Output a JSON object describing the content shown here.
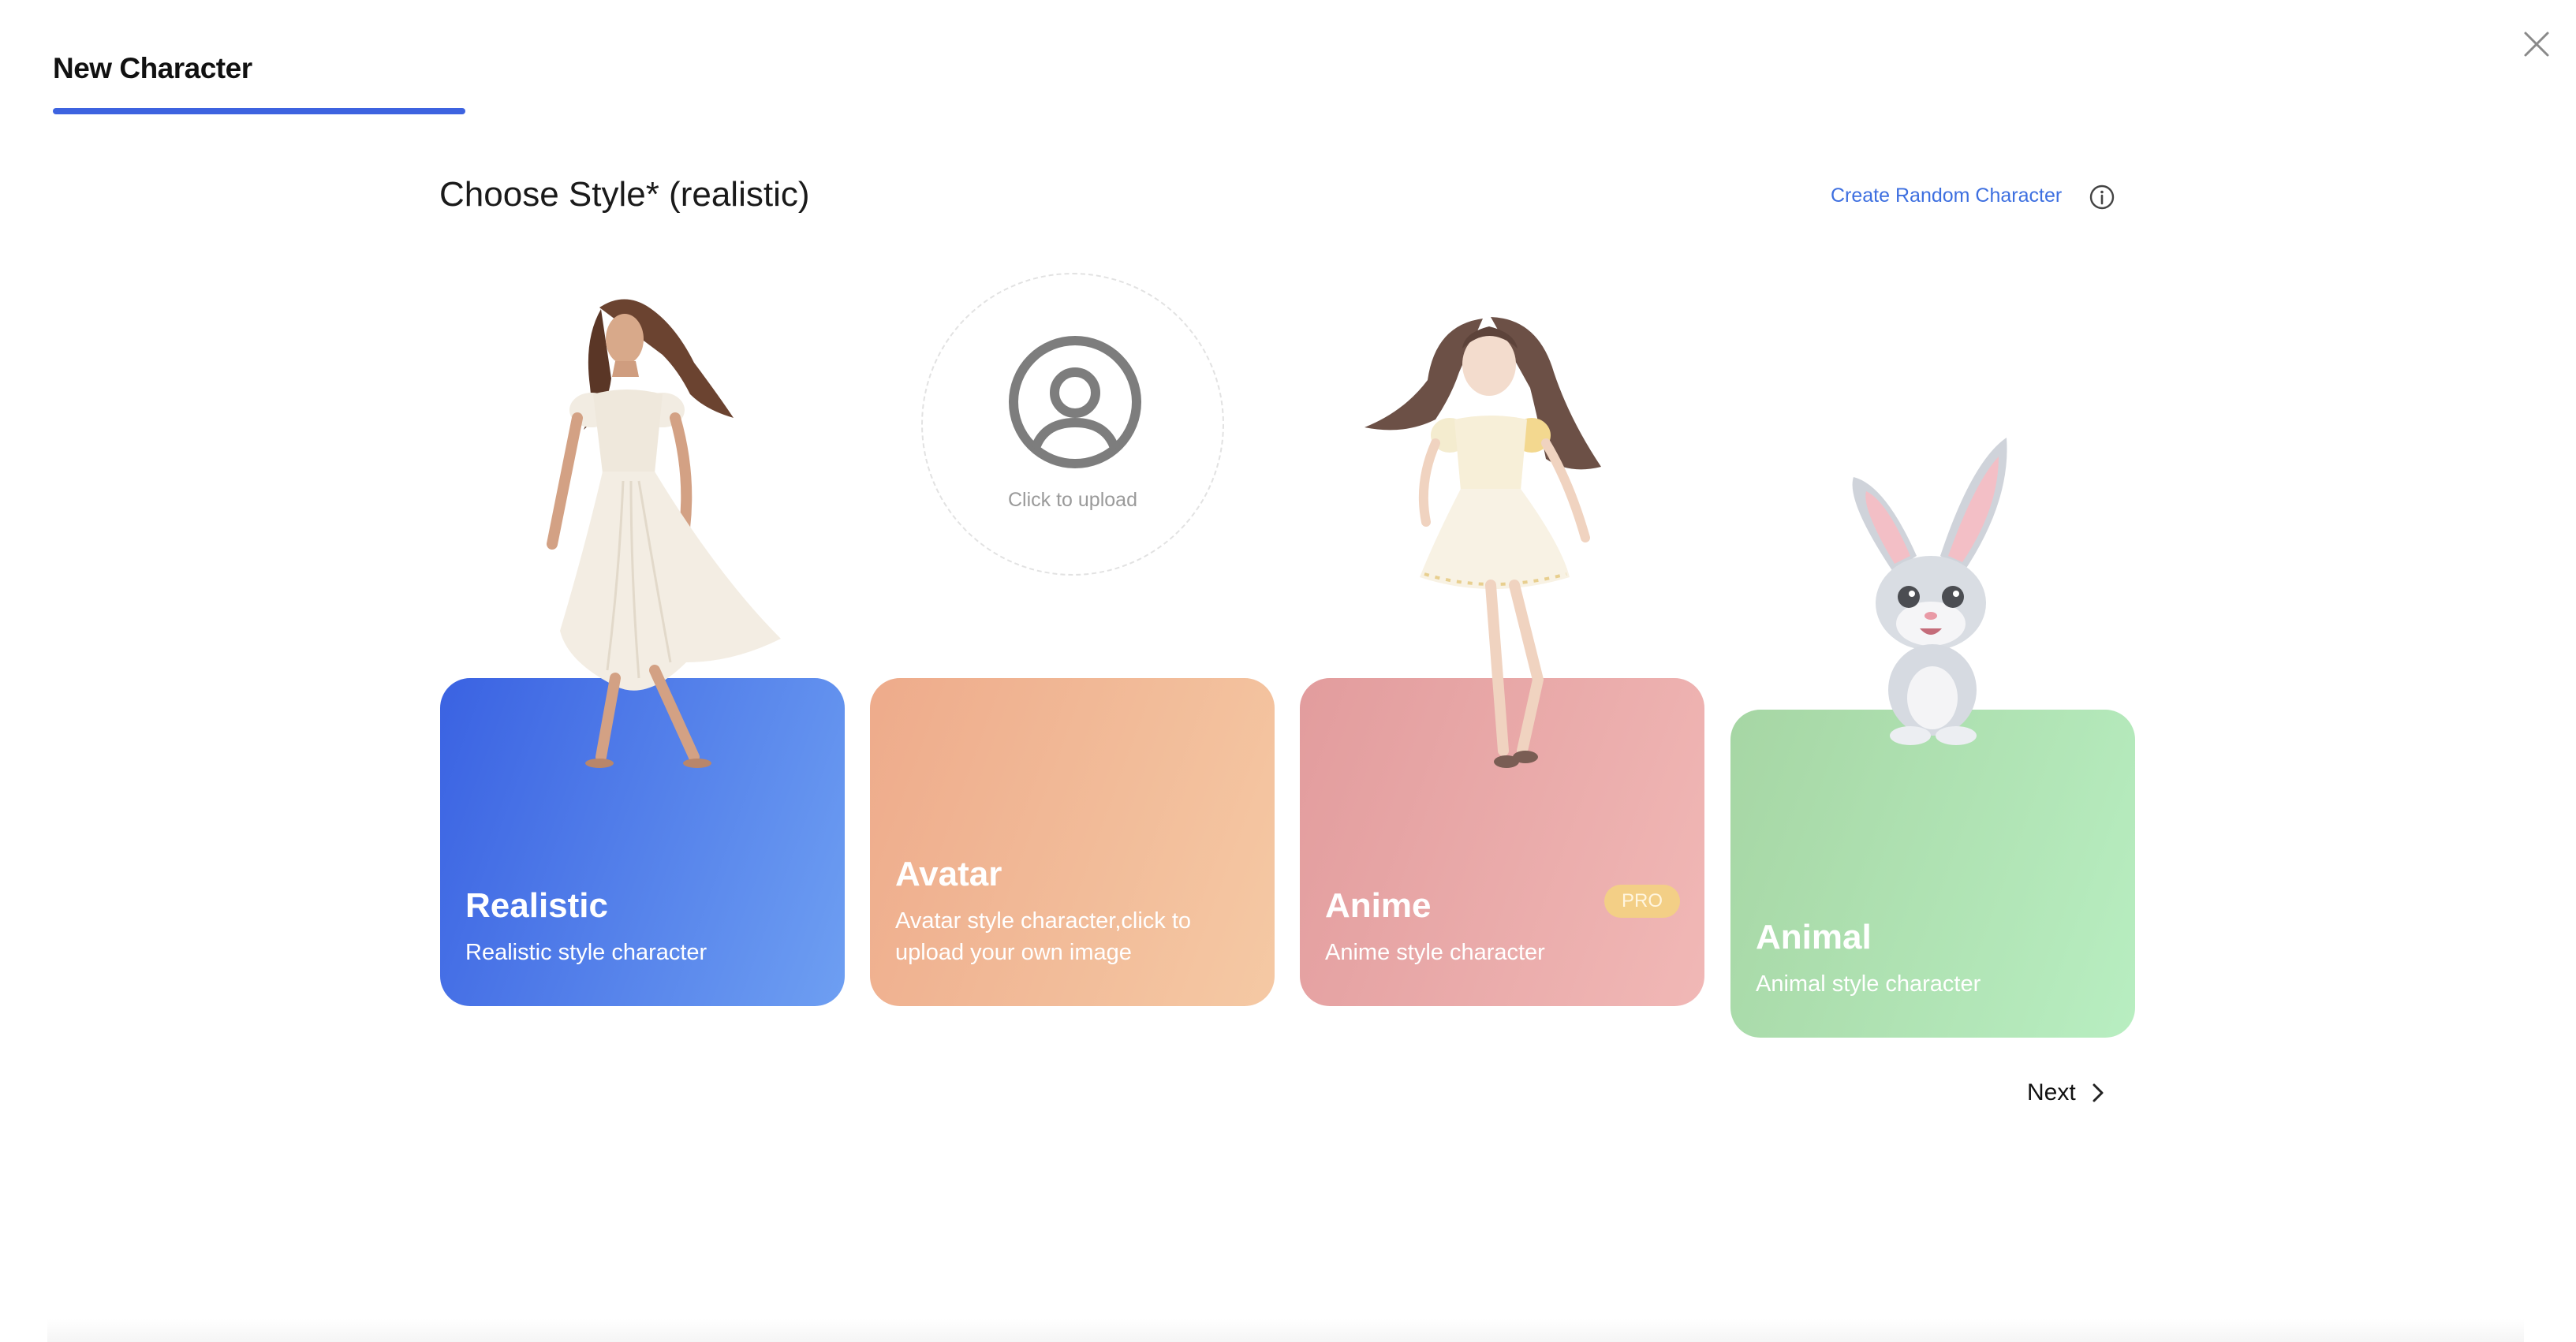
{
  "header": {
    "tab_title": "New Character"
  },
  "main": {
    "section_title": "Choose Style* (realistic)",
    "random_link": "Create Random Character",
    "upload_text": "Click to upload",
    "cards": [
      {
        "title": "Realistic",
        "desc": "Realistic style character"
      },
      {
        "title": "Avatar",
        "desc": "Avatar style character,click to upload your own image"
      },
      {
        "title": "Anime",
        "desc": "Anime style character",
        "badge": "PRO"
      },
      {
        "title": "Animal",
        "desc": "Animal style character"
      }
    ],
    "next_label": "Next"
  },
  "colors": {
    "accent": "#3d63e0",
    "link": "#3d6fe0",
    "realistic": "#3a62e2",
    "avatar": "#eeab8b",
    "anime": "#e29c9d",
    "animal": "#a6d6a4",
    "pro_badge": "#f3cf86"
  },
  "icons": {
    "close": "close-icon",
    "info": "info-icon",
    "upload": "user-circle-icon",
    "next": "chevron-right-icon"
  }
}
